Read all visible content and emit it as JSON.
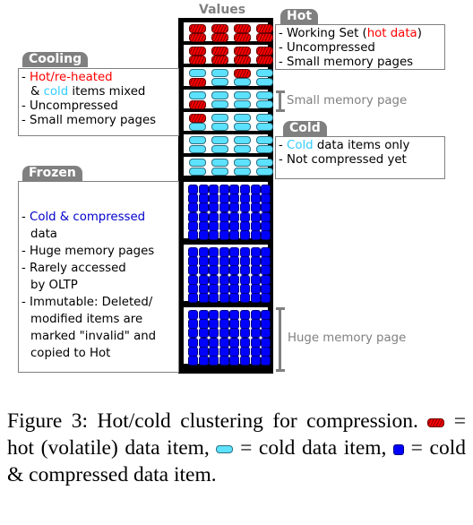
{
  "diagram": {
    "column_title": "Values",
    "colors": {
      "hot": "#ff0000",
      "cold": "#5ce1ff",
      "compressed": "#0000ff",
      "tag_bg": "#808080",
      "column_bg": "#000000"
    },
    "small_pages": [
      {
        "rows": [
          [
            "hot",
            "hot",
            "hot",
            "hot"
          ],
          [
            "hot",
            "hot",
            "hot",
            "hot"
          ]
        ]
      },
      {
        "rows": [
          [
            "hot",
            "hot",
            "hot",
            "hot"
          ],
          [
            "hot",
            "hot",
            "hot",
            "hot"
          ]
        ]
      },
      {
        "rows": [
          [
            "cold",
            "cold",
            "hot",
            "cold"
          ],
          [
            "hot",
            "cold",
            "cold",
            "cold"
          ]
        ]
      },
      {
        "rows": [
          [
            "cold",
            "cold",
            "cold",
            "cold"
          ],
          [
            "hot",
            "cold",
            "cold",
            "cold"
          ]
        ]
      },
      {
        "rows": [
          [
            "hot",
            "cold",
            "cold",
            "cold"
          ],
          [
            "cold",
            "cold",
            "cold",
            "cold"
          ]
        ]
      },
      {
        "rows": [
          [
            "cold",
            "cold",
            "cold",
            "cold"
          ],
          [
            "cold",
            "cold",
            "cold",
            "cold"
          ]
        ]
      },
      {
        "rows": [
          [
            "cold",
            "cold",
            "cold",
            "cold"
          ],
          [
            "cold",
            "cold",
            "cold",
            "cold"
          ]
        ]
      }
    ],
    "huge_pages": [
      {
        "cols": 8,
        "rows": 6,
        "item": "compressed"
      },
      {
        "cols": 8,
        "rows": 6,
        "item": "compressed"
      },
      {
        "cols": 8,
        "rows": 6,
        "item": "compressed"
      }
    ],
    "hot": {
      "tag": "Hot",
      "line1_prefix": "- Working Set (",
      "line1_highlight": "hot data",
      "line1_suffix": ")",
      "line2": "- Uncompressed",
      "line3": "- Small memory pages"
    },
    "cooling": {
      "tag": "Cooling",
      "line1_prefix": "- ",
      "line1_highlight": "Hot/re-heated",
      "line2_prefix": "& ",
      "line2_highlight": "cold",
      "line2_suffix": " items mixed",
      "line3": "- Uncompressed",
      "line4": "- Small memory pages"
    },
    "cold": {
      "tag": "Cold",
      "line1_prefix": "- ",
      "line1_highlight": "Cold",
      "line1_suffix": " data items only",
      "line2": "- Not compressed yet"
    },
    "frozen": {
      "tag": "Frozen",
      "line1_prefix": "- ",
      "line1_highlight": "Cold & compressed",
      "line2": "data",
      "line3": "- Huge memory pages",
      "line4": "- Rarely accessed",
      "line5": "by OLTP",
      "line6": "- Immutable: Deleted/",
      "line7": "modified items are",
      "line8": "marked \"invalid\" and",
      "line9": "copied to Hot"
    },
    "small_page_label": "Small memory page",
    "huge_page_label": "Huge memory page"
  },
  "caption": {
    "part1": "Figure 3:  Hot/cold clustering for compression.",
    "legend_hot": "= hot (volatile) data item,",
    "legend_cold": "= cold data item,",
    "legend_compressed": "= cold & compressed data item."
  }
}
